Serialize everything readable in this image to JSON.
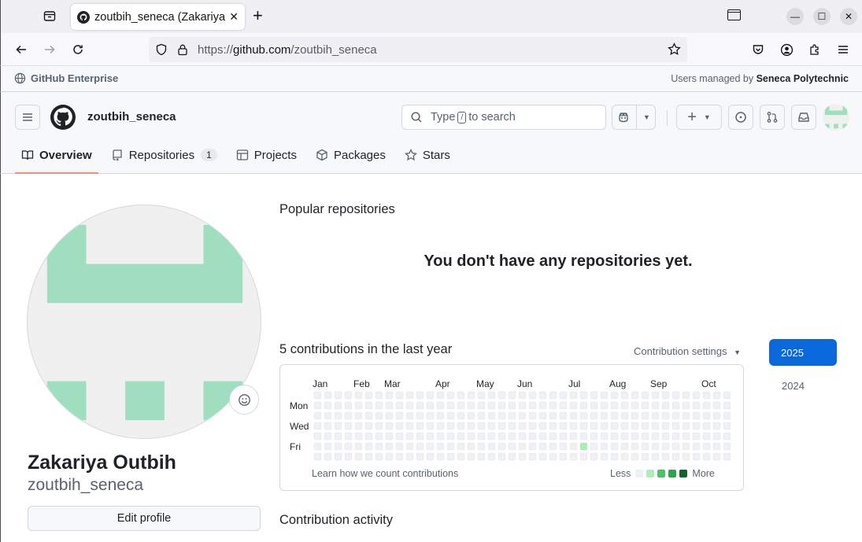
{
  "browser": {
    "tab_title": "zoutbih_seneca (Zakariya Outbih)",
    "url_prefix": "https://",
    "url_host": "github.com",
    "url_path": "/zoutbih_seneca"
  },
  "enterprise": {
    "label": "GitHub Enterprise",
    "managed_prefix": "Users managed by ",
    "managed_org": "Seneca Polytechnic"
  },
  "header": {
    "username": "zoutbih_seneca",
    "search_type": "Type",
    "search_key": "/",
    "search_rest": "to search"
  },
  "tabs": [
    {
      "label": "Overview",
      "active": true
    },
    {
      "label": "Repositories",
      "count": "1"
    },
    {
      "label": "Projects"
    },
    {
      "label": "Packages"
    },
    {
      "label": "Stars"
    }
  ],
  "profile": {
    "full_name": "Zakariya Outbih",
    "login": "zoutbih_seneca",
    "edit_label": "Edit profile",
    "avatar_color": "#9fdfbf"
  },
  "main": {
    "popular_title": "Popular repositories",
    "no_repos": "You don't have any repositories yet.",
    "contrib_title": "5 contributions in the last year",
    "contrib_settings": "Contribution settings",
    "learn_link": "Learn how we count contributions",
    "legend_less": "Less",
    "legend_more": "More",
    "activity_title": "Contribution activity"
  },
  "graph": {
    "months": [
      "Jan",
      "Feb",
      "Mar",
      "Apr",
      "May",
      "Jun",
      "Jul",
      "Aug",
      "Sep",
      "Oct"
    ],
    "day_labels": [
      "Mon",
      "Wed",
      "Fri"
    ],
    "legend_colors": [
      "#eff2f5",
      "#aceebb",
      "#4ac26b",
      "#2da44e",
      "#116329"
    ],
    "active_cell": {
      "week": 26,
      "day": 5,
      "level": 1
    }
  },
  "years": [
    "2025",
    "2024"
  ]
}
